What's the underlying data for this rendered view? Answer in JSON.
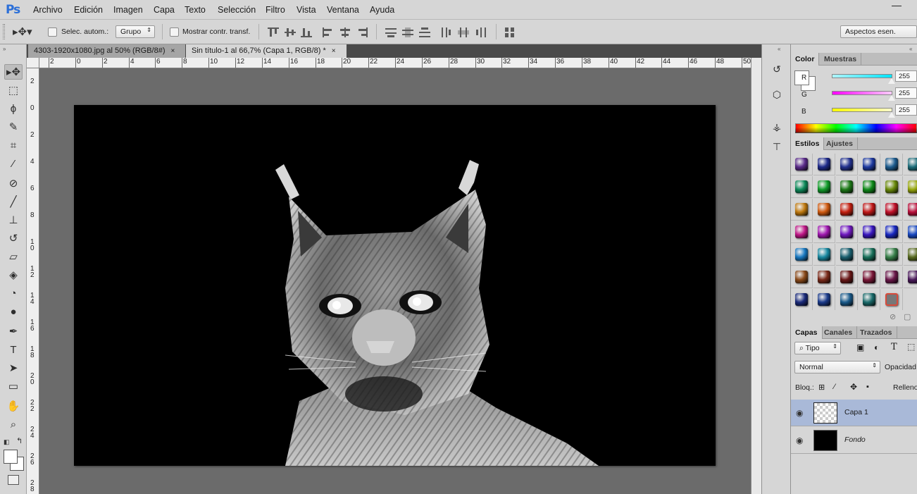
{
  "app": {
    "logo": "Ps",
    "menu": [
      "Archivo",
      "Edición",
      "Imagen",
      "Capa",
      "Texto",
      "Selección",
      "Filtro",
      "Vista",
      "Ventana",
      "Ayuda"
    ],
    "window_minimize": "—"
  },
  "options_bar": {
    "auto_select_label": "Selec. autom.:",
    "group_select_value": "Grupo",
    "show_transform_label": "Mostrar contr. transf.",
    "workspace_label": "Aspectos esen."
  },
  "document_tabs": [
    {
      "label": "4303-1920x1080.jpg al 50% (RGB/8#)",
      "close": "×",
      "active": false
    },
    {
      "label": "Sin título-1 al 66,7% (Capa 1, RGB/8) *",
      "close": "×",
      "active": true
    }
  ],
  "ruler_top": [
    "2",
    "0",
    "2",
    "4",
    "6",
    "8",
    "10",
    "12",
    "14",
    "16",
    "18",
    "20",
    "22",
    "24",
    "26",
    "28",
    "30",
    "32",
    "34",
    "36",
    "38",
    "40",
    "42",
    "44",
    "46",
    "48",
    "50"
  ],
  "ruler_left": [
    "2",
    "0",
    "2",
    "4",
    "6",
    "8",
    "10",
    "12",
    "14",
    "16",
    "18",
    "20",
    "22",
    "24",
    "26",
    "28"
  ],
  "tools": [
    {
      "name": "move-tool",
      "icon": "▸✥"
    },
    {
      "name": "marquee-tool",
      "icon": "⬚"
    },
    {
      "name": "lasso-tool",
      "icon": "ϕ"
    },
    {
      "name": "quick-select-tool",
      "icon": "✎"
    },
    {
      "name": "crop-tool",
      "icon": "⌗"
    },
    {
      "name": "eyedropper-tool",
      "icon": "⁄"
    },
    {
      "name": "healing-brush-tool",
      "icon": "⊘"
    },
    {
      "name": "brush-tool",
      "icon": "╱"
    },
    {
      "name": "clone-stamp-tool",
      "icon": "⊥"
    },
    {
      "name": "history-brush-tool",
      "icon": "↺"
    },
    {
      "name": "eraser-tool",
      "icon": "▱"
    },
    {
      "name": "paint-bucket-tool",
      "icon": "◈"
    },
    {
      "name": "blur-tool",
      "icon": "◔"
    },
    {
      "name": "dodge-tool",
      "icon": "●"
    },
    {
      "name": "pen-tool",
      "icon": "✒"
    },
    {
      "name": "type-tool",
      "icon": "T"
    },
    {
      "name": "path-select-tool",
      "icon": "➤"
    },
    {
      "name": "rectangle-tool",
      "icon": "▭"
    },
    {
      "name": "hand-tool",
      "icon": "✋"
    },
    {
      "name": "zoom-tool",
      "icon": "⌕"
    }
  ],
  "right_panels": {
    "color_tabs": [
      "Color",
      "Muestras"
    ],
    "channels": [
      {
        "label": "R",
        "value": "255",
        "color": "#00e5ff"
      },
      {
        "label": "G",
        "value": "255",
        "color": "#ff00ff"
      },
      {
        "label": "B",
        "value": "255",
        "color": "#ffff00"
      }
    ],
    "styles_tabs": [
      "Estilos",
      "Ajustes"
    ],
    "style_swatch_colors": [
      [
        "#5a2b8a",
        "#1e2a8a",
        "#23328f",
        "#1e3aa0",
        "#1d5c8f",
        "#1d6d7a"
      ],
      [
        "#0d8a5a",
        "#119c2a",
        "#1d7a18",
        "#0f8a1a",
        "#6a8a0a",
        "#98a80e"
      ],
      [
        "#c07a10",
        "#d05a10",
        "#c42010",
        "#c01818",
        "#c01028",
        "#b80f3a"
      ],
      [
        "#c01888",
        "#a018b0",
        "#7018c0",
        "#3a18c0",
        "#1828c0",
        "#1848c0"
      ],
      [
        "#1878c0",
        "#1888a0",
        "#1a6070",
        "#18705a",
        "#38804a",
        "#586a20"
      ],
      [
        "#8a4a1a",
        "#7a2a1a",
        "#6a1818",
        "#7a1838",
        "#6a184a",
        "#4a1a5a"
      ],
      [
        "#1a2a7a",
        "#1a3a8a",
        "#1a5a8a",
        "#1a6a6a",
        "#d84a3a",
        ""
      ]
    ],
    "layers_tabs": [
      "Capas",
      "Canales",
      "Trazados"
    ],
    "filter_select": "Tipo",
    "blend_mode": "Normal",
    "opacity_label": "Opacidad:",
    "lock_label": "Bloq.:",
    "fill_label": "Relleno:",
    "layers": [
      {
        "name": "Capa 1",
        "selected": true,
        "italic": false
      },
      {
        "name": "Fondo",
        "selected": false,
        "italic": true
      }
    ]
  }
}
